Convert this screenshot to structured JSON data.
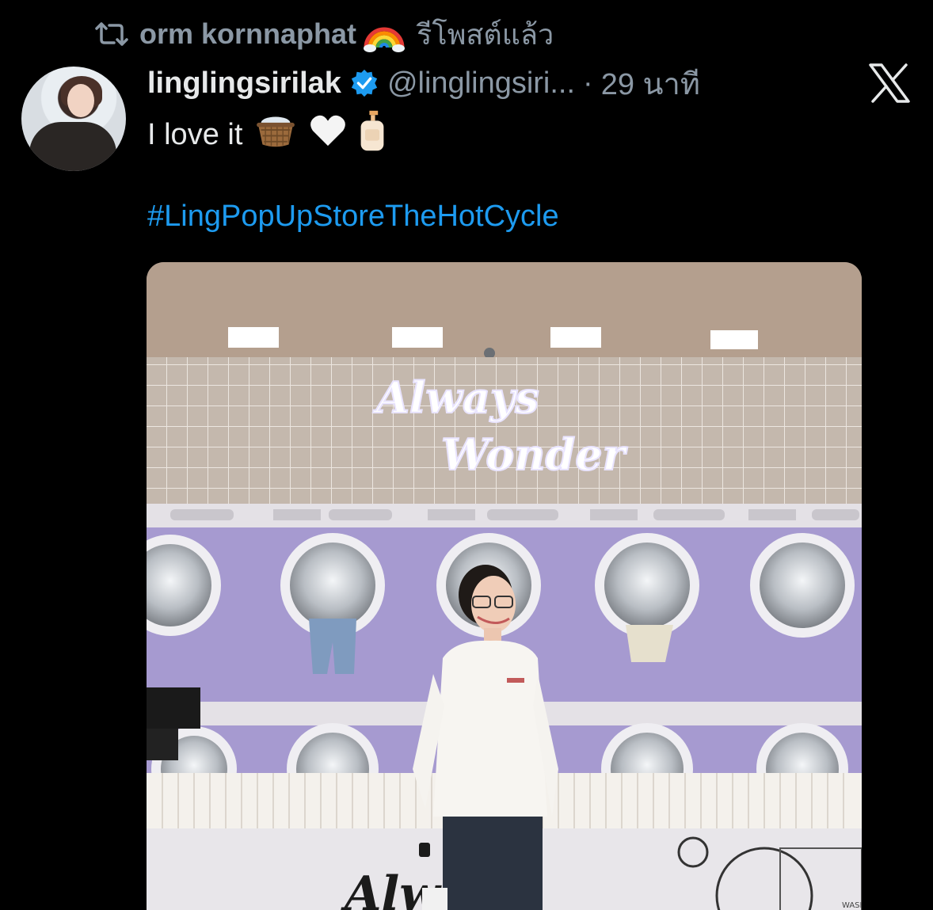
{
  "retweet": {
    "name": "orm kornnaphat",
    "label": "รีโพสต์แล้ว"
  },
  "author": {
    "display_name": "linglingsirilak",
    "handle": "@linglingsiri...",
    "separator": "·",
    "time": "29 นาที"
  },
  "tweet": {
    "text": "I love it",
    "emojis": [
      "basket-icon",
      "white-heart-icon",
      "lotion-bottle-icon"
    ],
    "hashtag": "#LingPopUpStoreTheHotCycle"
  },
  "media": {
    "sign_line1": "Always",
    "sign_line2": "Wonder",
    "counter_text": "Alw",
    "corner_label": "WASH"
  },
  "colors": {
    "background": "#000000",
    "text": "#e7e9ea",
    "muted": "#8b98a5",
    "link": "#1d9bf0",
    "verified": "#1d9bf0",
    "wall": "#a69ad0"
  }
}
